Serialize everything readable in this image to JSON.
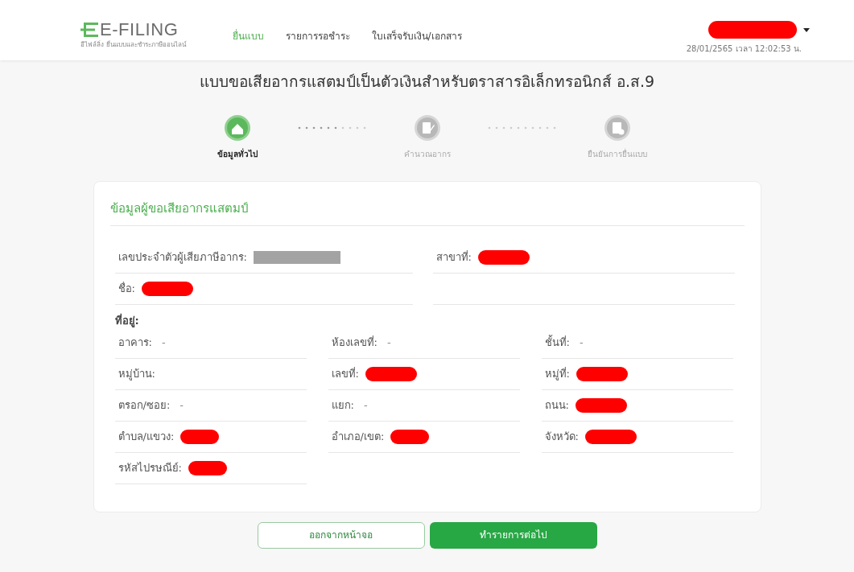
{
  "header": {
    "logo": "E-FILING",
    "tagline": "อีไฟล์ลิ่ง ยื่นแบบและชำระภาษีออนไลน์",
    "nav": [
      {
        "label": "ยื่นแบบ",
        "selected": true
      },
      {
        "label": "รายการรอชำระ",
        "selected": false
      },
      {
        "label": "ใบเสร็จรับเงิน/เอกสาร",
        "selected": false
      }
    ],
    "user": {
      "redacted": true,
      "color": "#ff0000"
    },
    "datetime": "28/01/2565 เวลา 12:02:53 น."
  },
  "title": "แบบขอเสียอากรแสตมป์เป็นตัวเงินสำหรับตราสารอิเล็กทรอนิกส์ อ.ส.9",
  "steps": [
    {
      "label": "ข้อมูลทั่วไป",
      "selected": true,
      "kind": "house"
    },
    {
      "label": "คำนวณอากร",
      "selected": false,
      "kind": "calc"
    },
    {
      "label": "ยืนยันการยื่นแบบ",
      "selected": false,
      "kind": "confirm"
    }
  ],
  "card": {
    "heading": "ข้อมูลผู้ขอเสียอากรแสตมป์",
    "taxpayer_rows": [
      [
        {
          "label": "เลขประจำตัวผู้เสียภาษีอากร:",
          "redacted": true,
          "color": "#a3a3a3"
        },
        {
          "label": "สาขาที่:",
          "redacted": true,
          "color": "#ff0000"
        }
      ],
      [
        {
          "label": "ชื่อ:",
          "redacted": true,
          "color": "#ff0000"
        }
      ]
    ],
    "address_heading": "ที่อยู่:",
    "address_rows": [
      [
        {
          "label": "อาคาร:",
          "value": "-"
        },
        {
          "label": "ห้องเลขที่:",
          "value": "-"
        },
        {
          "label": "ชั้นที่:",
          "value": "-"
        }
      ],
      [
        {
          "label": "หมู่บ้าน:"
        },
        {
          "label": "เลขที่:",
          "redacted": true,
          "color": "#ff0000"
        },
        {
          "label": "หมู่ที่:",
          "redacted": true,
          "color": "#ff0000"
        }
      ],
      [
        {
          "label": "ตรอก/ซอย:",
          "value": "-"
        },
        {
          "label": "แยก:",
          "value": "-"
        },
        {
          "label": "ถนน:",
          "redacted": true,
          "color": "#ff0000"
        }
      ],
      [
        {
          "label": "ตำบล/แขวง:",
          "redacted": true,
          "color": "#ff0000"
        },
        {
          "label": "อำเภอ/เขต:",
          "redacted": true,
          "color": "#ff0000"
        },
        {
          "label": "จังหวัด:",
          "redacted": true,
          "color": "#ff0000"
        }
      ],
      [
        {
          "label": "รหัสไปรษณีย์:",
          "redacted": true,
          "color": "#ff0000"
        }
      ]
    ]
  },
  "buttons": [
    {
      "label": "ออกจากหน้าจอ",
      "kind": "secondary"
    },
    {
      "label": "ทำรายการต่อไป",
      "kind": "primary"
    }
  ]
}
